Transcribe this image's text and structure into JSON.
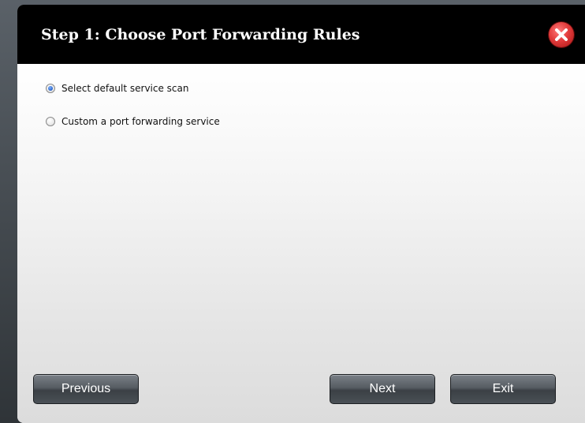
{
  "dialog": {
    "title": "Step 1: Choose Port Forwarding Rules",
    "close_icon": "close-x-icon",
    "options": [
      {
        "label": "Select default service scan",
        "checked": true
      },
      {
        "label": "Custom a port forwarding service",
        "checked": false
      }
    ],
    "buttons": {
      "previous": "Previous",
      "next": "Next",
      "exit": "Exit"
    }
  },
  "colors": {
    "titlebar": "#000000",
    "close_red": "#e23b3b",
    "button_dark": "#4a5056"
  }
}
